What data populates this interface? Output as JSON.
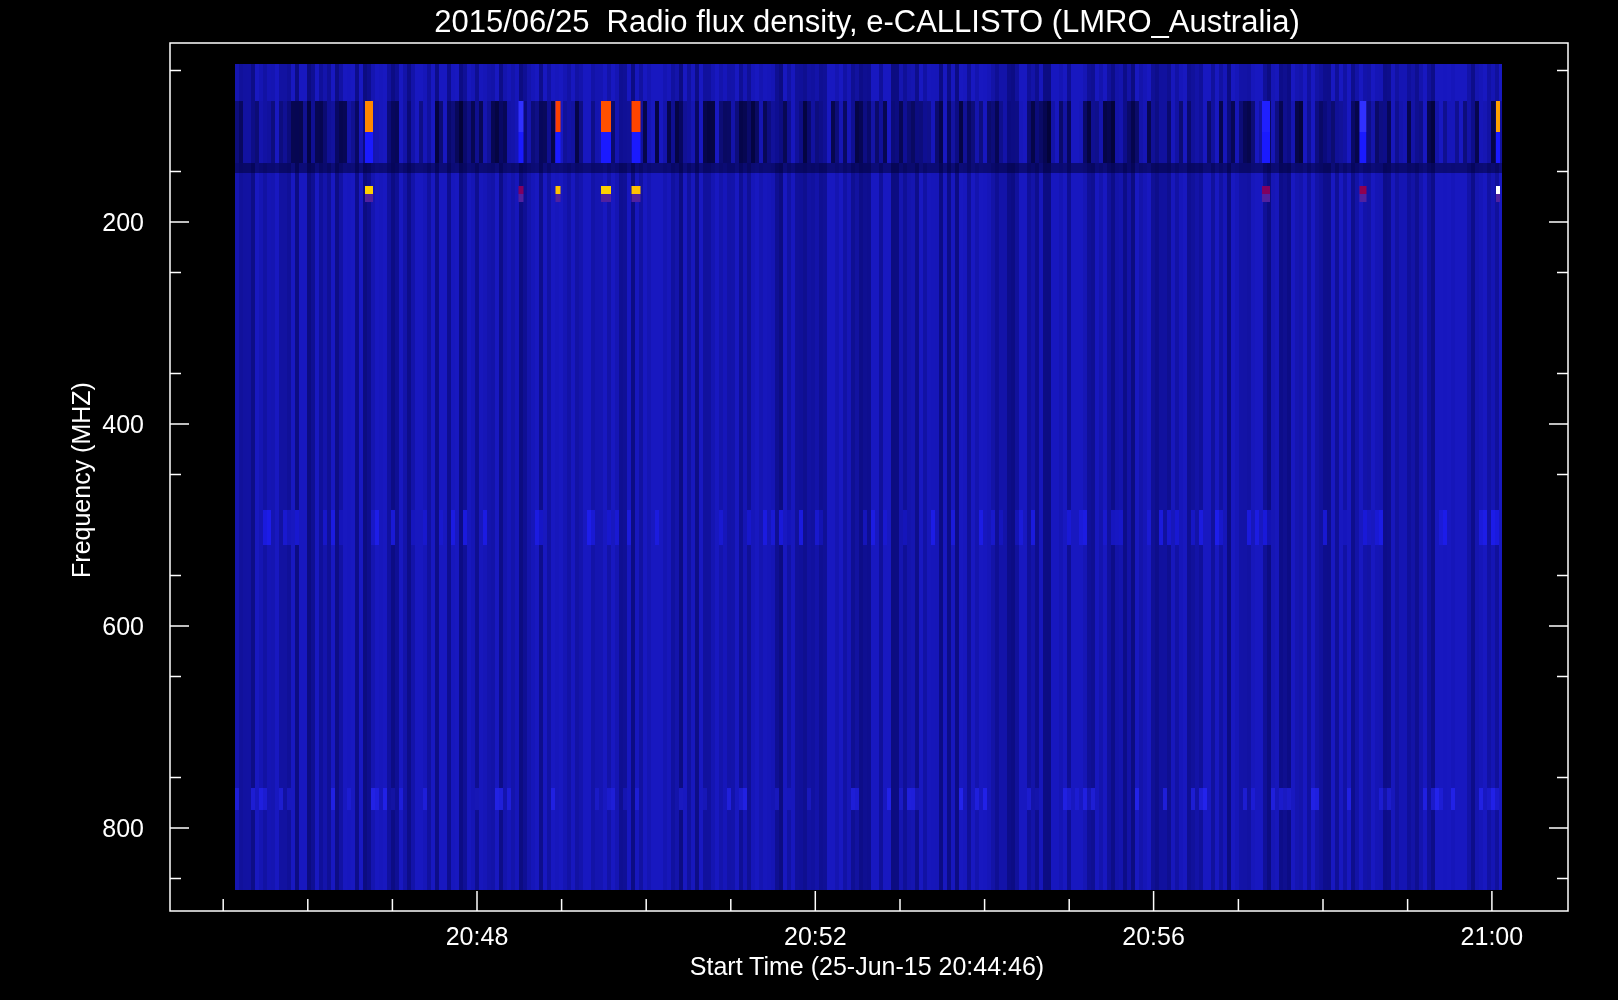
{
  "title": "2015/06/25  Radio flux density, e-CALLISTO (LMRO_Australia)",
  "y_axis": {
    "label": "Frequency (MHZ)",
    "ticks": [
      "200",
      "400",
      "600",
      "800"
    ]
  },
  "x_axis": {
    "label": "Start Time (25-Jun-15 20:44:46)",
    "ticks": [
      "20:48",
      "20:52",
      "20:56",
      "21:00"
    ]
  }
}
